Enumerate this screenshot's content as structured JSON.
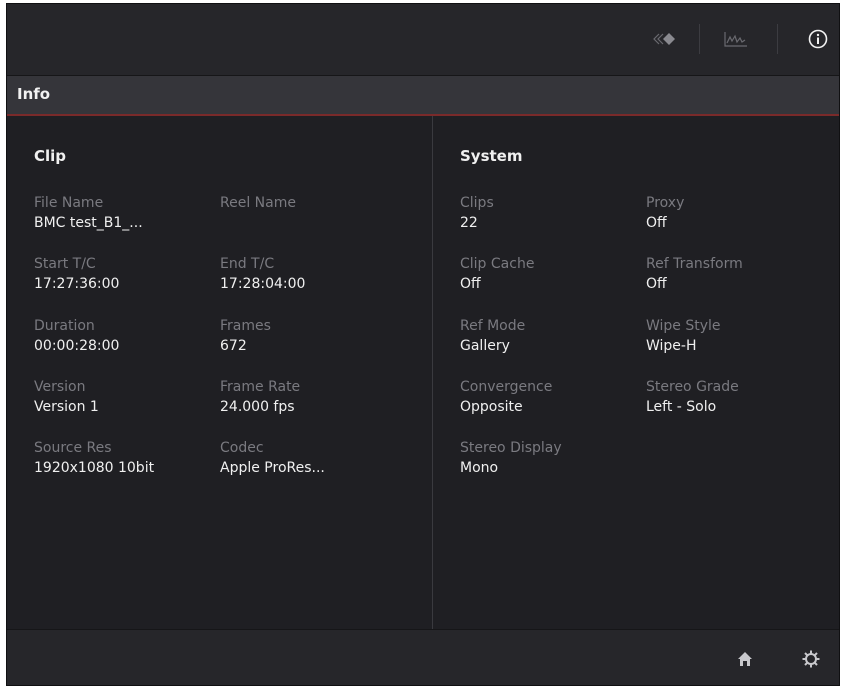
{
  "panel_title": "Info",
  "clip": {
    "heading": "Clip",
    "fields": [
      {
        "label": "File Name",
        "value": "BMC test_B1_..."
      },
      {
        "label": "Reel Name",
        "value": ""
      },
      {
        "label": "Start T/C",
        "value": "17:27:36:00"
      },
      {
        "label": "End T/C",
        "value": "17:28:04:00"
      },
      {
        "label": "Duration",
        "value": "00:00:28:00"
      },
      {
        "label": "Frames",
        "value": "672"
      },
      {
        "label": "Version",
        "value": "Version 1"
      },
      {
        "label": "Frame Rate",
        "value": "24.000 fps"
      },
      {
        "label": "Source Res",
        "value": "1920x1080 10bit"
      },
      {
        "label": "Codec",
        "value": "Apple ProRes..."
      }
    ]
  },
  "system": {
    "heading": "System",
    "fields": [
      {
        "label": "Clips",
        "value": "22"
      },
      {
        "label": "Proxy",
        "value": "Off"
      },
      {
        "label": "Clip Cache",
        "value": "Off"
      },
      {
        "label": "Ref Transform",
        "value": "Off"
      },
      {
        "label": "Ref Mode",
        "value": "Gallery"
      },
      {
        "label": "Wipe Style",
        "value": "Wipe-H"
      },
      {
        "label": "Convergence",
        "value": "Opposite"
      },
      {
        "label": "Stereo Grade",
        "value": "Left - Solo"
      },
      {
        "label": "Stereo Display",
        "value": "Mono"
      }
    ]
  },
  "toolbar": {
    "icons": [
      "keyframes-icon",
      "scopes-icon",
      "info-icon"
    ],
    "active": "info-icon"
  },
  "footer": {
    "icons": [
      "home-icon",
      "settings-icon"
    ]
  },
  "colors": {
    "background": "#232327",
    "accent_underline": "#7a2a2a",
    "label": "#7a7a80",
    "value": "#f0f0f0"
  }
}
